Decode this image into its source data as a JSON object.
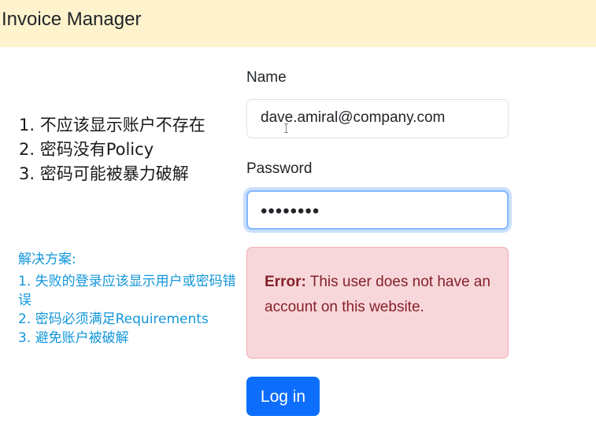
{
  "header": {
    "title": "Invoice Manager"
  },
  "notes": {
    "items": [
      "1. 不应该显示账户不存在",
      "2. 密码没有Policy",
      "3. 密码可能被暴力破解"
    ]
  },
  "solutions": {
    "title": "解决方案:",
    "items": [
      "1. 失败的登录应该显示用户或密码错误",
      "2. 密码必须满足Requirements",
      "3. 避免账户被破解"
    ]
  },
  "form": {
    "name_label": "Name",
    "name_value": "dave.amiral@company.com",
    "password_label": "Password",
    "password_value": "••••••••",
    "error_strong": "Error:",
    "error_message": " This user does not have an account on this website.",
    "login_label": "Log in"
  },
  "colors": {
    "header_bg": "#fff3cd",
    "note_text": "#1a1a1a",
    "solution_text": "#1296db",
    "error_bg": "#f8d7da",
    "error_text": "#842029",
    "primary_button": "#0d6efd"
  }
}
